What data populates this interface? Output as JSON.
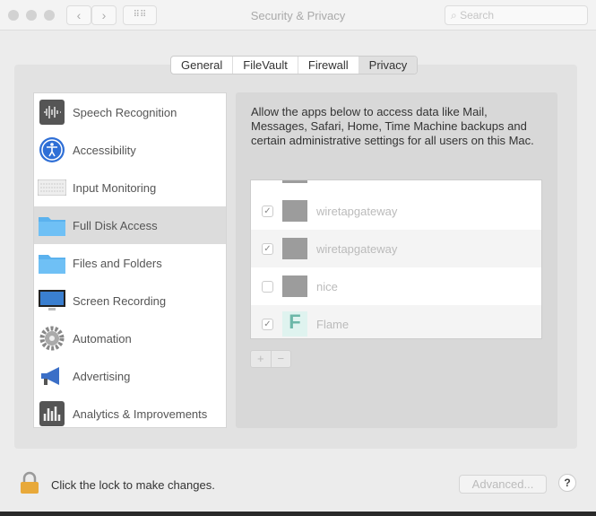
{
  "window": {
    "title": "Security & Privacy",
    "search_placeholder": "Search"
  },
  "tabs": [
    "General",
    "FileVault",
    "Firewall",
    "Privacy"
  ],
  "selected_tab": "Privacy",
  "sidebar": {
    "items": [
      {
        "label": "Speech Recognition",
        "icon": "waveform-icon"
      },
      {
        "label": "Accessibility",
        "icon": "accessibility-icon"
      },
      {
        "label": "Input Monitoring",
        "icon": "keyboard-icon"
      },
      {
        "label": "Full Disk Access",
        "icon": "folder-icon",
        "selected": true
      },
      {
        "label": "Files and Folders",
        "icon": "folder-icon"
      },
      {
        "label": "Screen Recording",
        "icon": "display-icon"
      },
      {
        "label": "Automation",
        "icon": "gear-icon"
      },
      {
        "label": "Advertising",
        "icon": "megaphone-icon"
      },
      {
        "label": "Analytics & Improvements",
        "icon": "chart-icon"
      }
    ]
  },
  "main": {
    "description": "Allow the apps below to access data like Mail, Messages, Safari, Home, Time Machine backups and certain administrative settings for all users on this Mac.",
    "apps": [
      {
        "name": "wiretapgateway",
        "checked": true
      },
      {
        "name": "wiretapgateway",
        "checked": true
      },
      {
        "name": "nice",
        "checked": false
      },
      {
        "name": "Flame",
        "checked": true
      }
    ],
    "add_label": "+",
    "remove_label": "−"
  },
  "footer": {
    "lock_text": "Click the lock to make changes.",
    "advanced_label": "Advanced...",
    "help_label": "?"
  }
}
